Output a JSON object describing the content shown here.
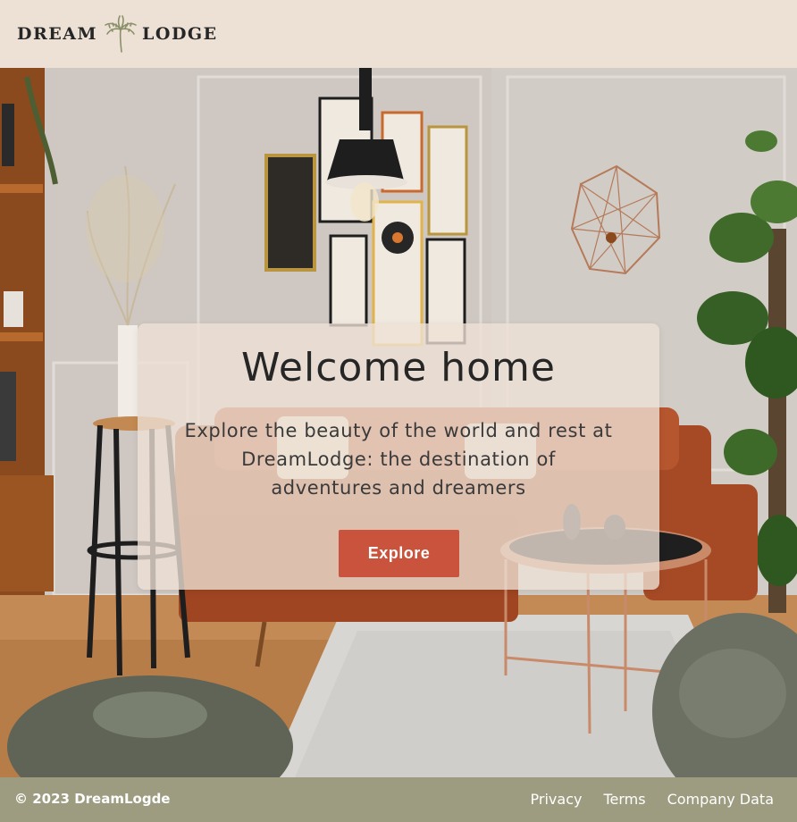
{
  "header": {
    "logo_left": "DREAM",
    "logo_right": "LODGE",
    "logo_icon": "palm-tree-icon"
  },
  "hero": {
    "image": "living-room-photo",
    "title": "Welcome home",
    "text": "Explore the beauty of the world and rest at DreamLodge: the destination of adventures and dreamers",
    "button_label": "Explore"
  },
  "footer": {
    "copyright": "© 2023 DreamLogde",
    "links": [
      "Privacy",
      "Terms",
      "Company Data"
    ]
  },
  "colors": {
    "header_bg": "#ede1d6",
    "accent": "#c9533c",
    "footer_bg": "#9d9c80",
    "text_dark": "#262626"
  }
}
